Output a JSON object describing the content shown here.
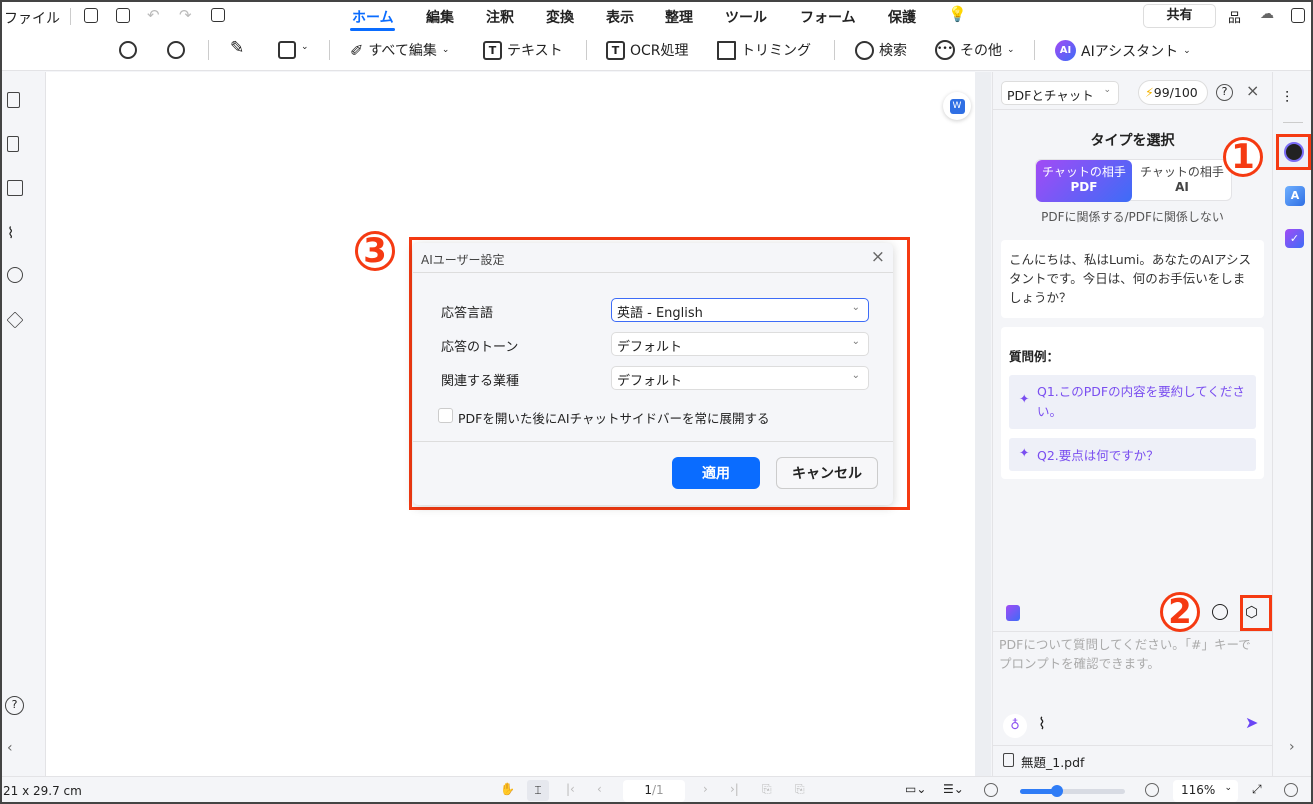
{
  "menu": {
    "file": "ファイル",
    "tabs": [
      "ホーム",
      "編集",
      "注釈",
      "変換",
      "表示",
      "整理",
      "ツール",
      "フォーム",
      "保護"
    ],
    "active_tab": "ホーム",
    "share": "共有"
  },
  "toolbar": {
    "edit_all": "すべて編集",
    "text": "テキスト",
    "ocr": "OCR処理",
    "crop": "トリミング",
    "search": "検索",
    "more": "その他",
    "ai": "AIアシスタント",
    "ai_badge": "AI"
  },
  "panel": {
    "mode": "PDFとチャット",
    "credits": "99/100",
    "type_title": "タイプを選択",
    "seg_pdf_top": "チャットの相手",
    "seg_pdf_bottom": "PDF",
    "seg_ai_top": "チャットの相手",
    "seg_ai_bottom": "AI",
    "seg_caption": "PDFに関係する/PDFに関係しない",
    "greeting": "こんにちは、私はLumi。あなたのAIアシスタントです。今日は、何のお手伝いをしましょうか？",
    "examples_title": "質問例：",
    "examples": [
      "Q1.このPDFの内容を要約してください。",
      "Q2.要点は何ですか？"
    ],
    "input_placeholder": "PDFについて質問してください。「#」キーでプロンプトを確認できます。",
    "file": "無題_1.pdf"
  },
  "dialog": {
    "title": "AIユーザー設定",
    "fields": [
      {
        "label": "応答言語",
        "value": "英語 - English"
      },
      {
        "label": "応答のトーン",
        "value": "デフォルト"
      },
      {
        "label": "関連する業種",
        "value": "デフォルト"
      }
    ],
    "checkbox": "PDFを開いた後にAIチャットサイドバーを常に展開する",
    "checkbox_checked": false,
    "apply": "適用",
    "cancel": "キャンセル"
  },
  "annotations": [
    "1",
    "2",
    "3"
  ],
  "status": {
    "page_size": "21 x 29.7 cm",
    "page_current": "1",
    "page_total": "/1",
    "zoom": "116%",
    "zoom_slider_fraction": 0.35
  },
  "colors": {
    "accent": "#0a6cff",
    "highlight": "#f53a12",
    "ai_purple": "#7a4ef0"
  }
}
